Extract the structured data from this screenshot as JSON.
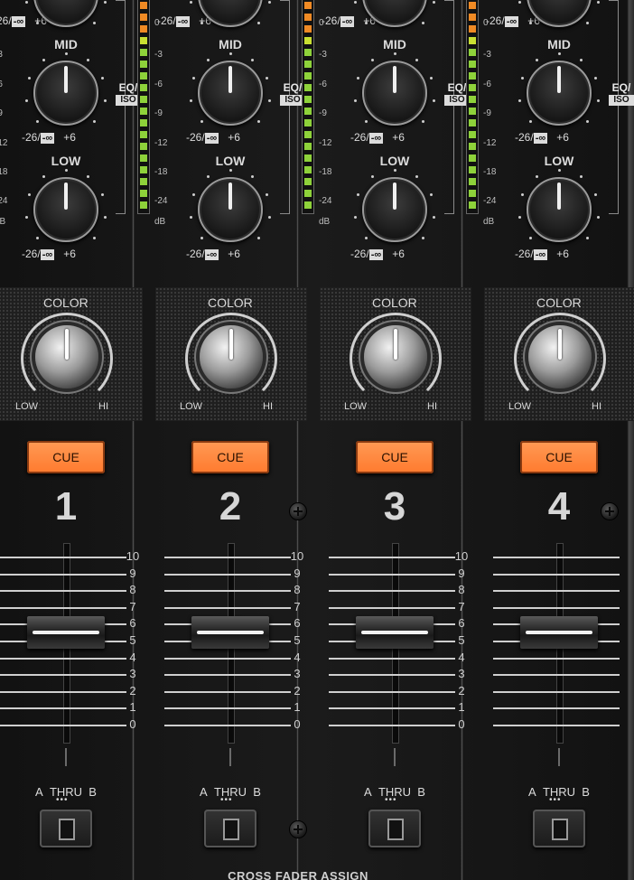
{
  "eq": {
    "high_range_min": "-26/",
    "infinity": "-∞",
    "range_max": "+6",
    "mid_label": "MID",
    "low_label": "LOW",
    "eq_tag": "EQ/",
    "iso_tag": "ISO"
  },
  "meter": {
    "scale": [
      "0",
      "-3",
      "-6",
      "-9",
      "-12",
      "-18",
      "-24",
      "dB"
    ]
  },
  "color": {
    "label": "COLOR",
    "low": "LOW",
    "hi": "HI"
  },
  "cue_label": "CUE",
  "channels": [
    {
      "number": "1"
    },
    {
      "number": "2"
    },
    {
      "number": "3"
    },
    {
      "number": "4"
    }
  ],
  "fader_scale": [
    "10",
    "9",
    "8",
    "7",
    "6",
    "5",
    "4",
    "3",
    "2",
    "1",
    "0"
  ],
  "fader_level": 0.55,
  "assign": {
    "label": "A THRU B",
    "a": "A",
    "thru": "THRU",
    "b": "B"
  },
  "crossfader_assign_title": "CROSS FADER ASSIGN",
  "colors": {
    "cue_orange": "#ff7a2e",
    "meter_green": "#8ed23a",
    "meter_orange": "#f08a24"
  }
}
